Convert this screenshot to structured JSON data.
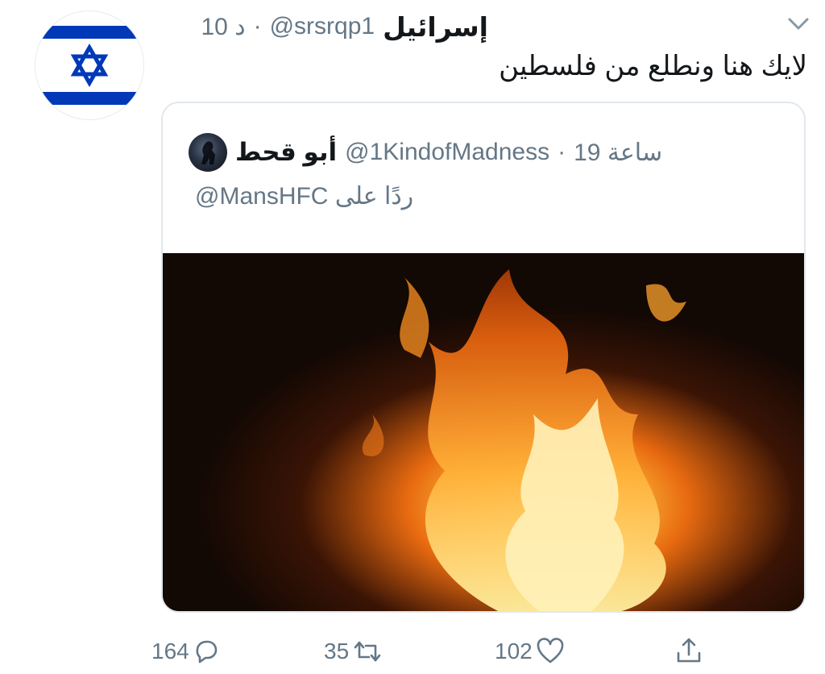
{
  "tweet": {
    "display_name": "إسرائيل",
    "handle": "@srsrqp1",
    "separator": "·",
    "time": "10 د",
    "text": "لايك هنا ونطلع من فلسطين"
  },
  "quoted": {
    "display_name": "أبو قحط",
    "handle": "@1KindofMadness",
    "separator": "·",
    "time": "19 ساعة",
    "reply_prefix": "ردًا على",
    "reply_mention": "@MansHFC"
  },
  "actions": {
    "reply_count": "164",
    "retweet_count": "35",
    "like_count": "102"
  },
  "colors": {
    "secondary_text": "#657786",
    "primary_text": "#14171a",
    "border": "#e1e8ed",
    "flag_blue": "#0038b8"
  },
  "icons": {
    "caret": "chevron-down-icon",
    "reply": "speech-bubble-icon",
    "retweet": "retweet-icon",
    "like": "heart-icon",
    "share": "share-icon"
  }
}
